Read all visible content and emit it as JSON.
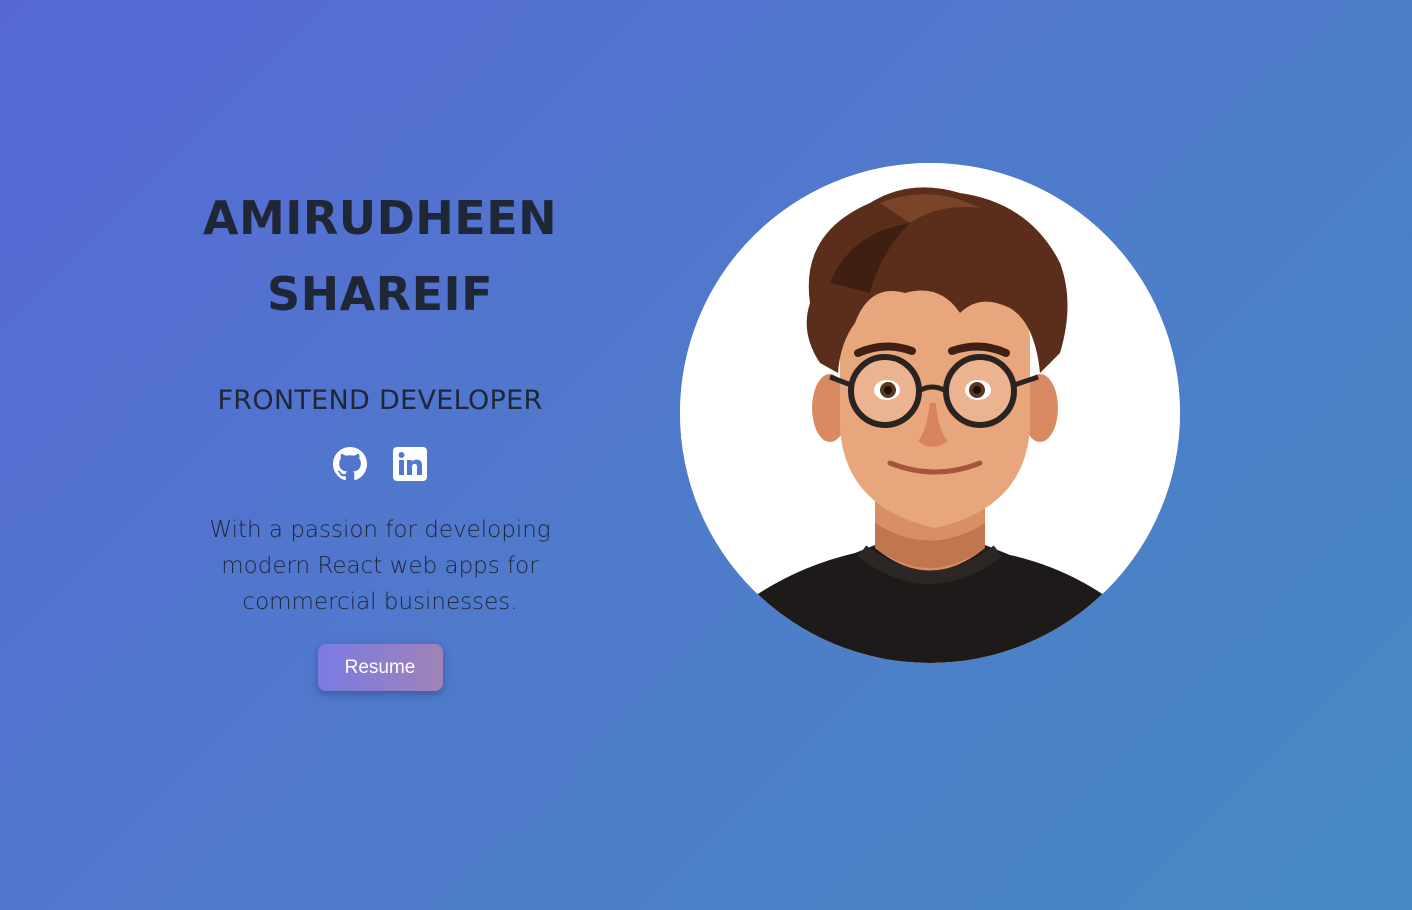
{
  "hero": {
    "name_line_1": "AMIRUDHEEN",
    "name_line_2": "SHAREIF",
    "role": "FRONTEND DEVELOPER",
    "bio": "With a passion for developing modern React web apps for commercial businesses.",
    "resume_label": "Resume"
  },
  "socials": [
    {
      "icon": "github-icon"
    },
    {
      "icon": "linkedin-icon"
    }
  ],
  "colors": {
    "background_start": "#5768d6",
    "background_end": "#4689c2",
    "text": "#1f2636",
    "button_start": "#7a7be3",
    "button_end": "#a082b8",
    "button_text": "#ffffff"
  }
}
